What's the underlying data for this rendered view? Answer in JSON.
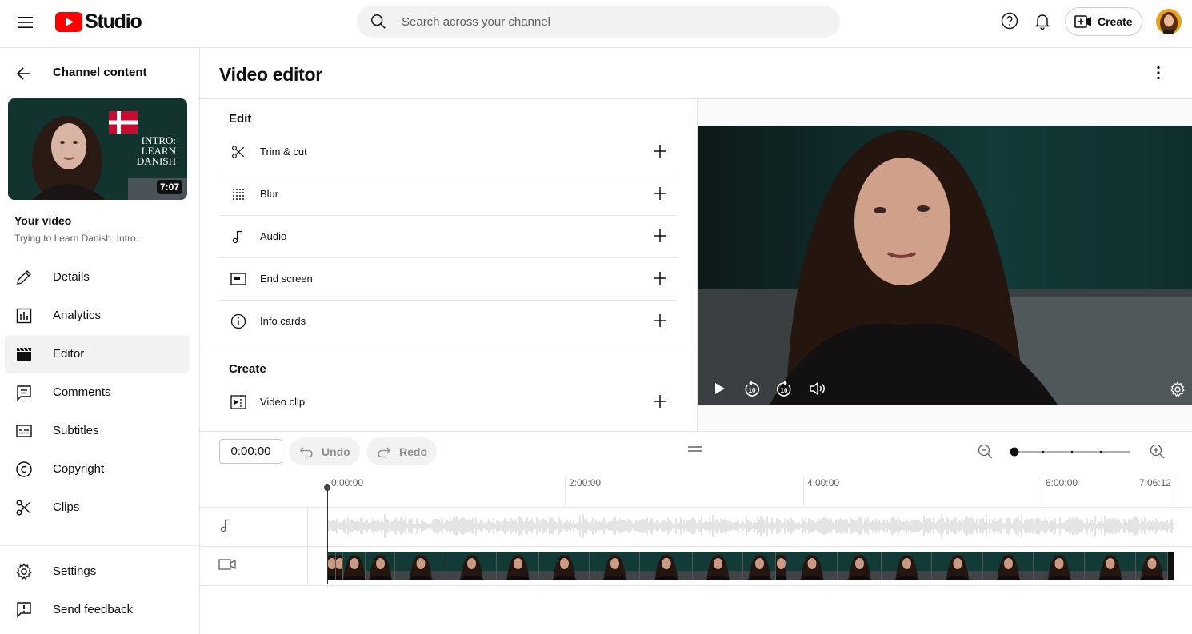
{
  "header": {
    "logo_text": "Studio",
    "search_placeholder": "Search across your channel",
    "create_label": "Create"
  },
  "sidebar": {
    "back_label": "Channel content",
    "thumbnail_text": [
      "INTRO:",
      "LEARN",
      "DANISH"
    ],
    "duration": "7:07",
    "your_video_label": "Your video",
    "video_title": "Trying to Learn Danish. Intro.",
    "items": [
      {
        "label": "Details",
        "icon": "pencil-icon"
      },
      {
        "label": "Analytics",
        "icon": "analytics-icon"
      },
      {
        "label": "Editor",
        "icon": "clapperboard-icon",
        "active": true
      },
      {
        "label": "Comments",
        "icon": "comment-icon"
      },
      {
        "label": "Subtitles",
        "icon": "subtitles-icon"
      },
      {
        "label": "Copyright",
        "icon": "copyright-icon"
      },
      {
        "label": "Clips",
        "icon": "scissors-icon"
      }
    ],
    "bottom_items": [
      {
        "label": "Settings",
        "icon": "gear-icon"
      },
      {
        "label": "Send feedback",
        "icon": "feedback-icon"
      }
    ]
  },
  "main": {
    "title": "Video editor",
    "edit_section": {
      "heading": "Edit",
      "tools": [
        {
          "label": "Trim & cut",
          "icon": "scissors-icon"
        },
        {
          "label": "Blur",
          "icon": "blur-icon"
        },
        {
          "label": "Audio",
          "icon": "music-note-icon"
        },
        {
          "label": "End screen",
          "icon": "end-screen-icon"
        },
        {
          "label": "Info cards",
          "icon": "info-icon"
        }
      ]
    },
    "create_section": {
      "heading": "Create",
      "tools": [
        {
          "label": "Video clip",
          "icon": "video-clip-icon"
        }
      ]
    }
  },
  "timeline": {
    "timecode": "0:00:00",
    "undo_label": "Undo",
    "redo_label": "Redo",
    "ruler": [
      "0:00:00",
      "2:00:00",
      "4:00:00",
      "6:00:00",
      "7:06:12"
    ],
    "zoom_level": 0
  }
}
